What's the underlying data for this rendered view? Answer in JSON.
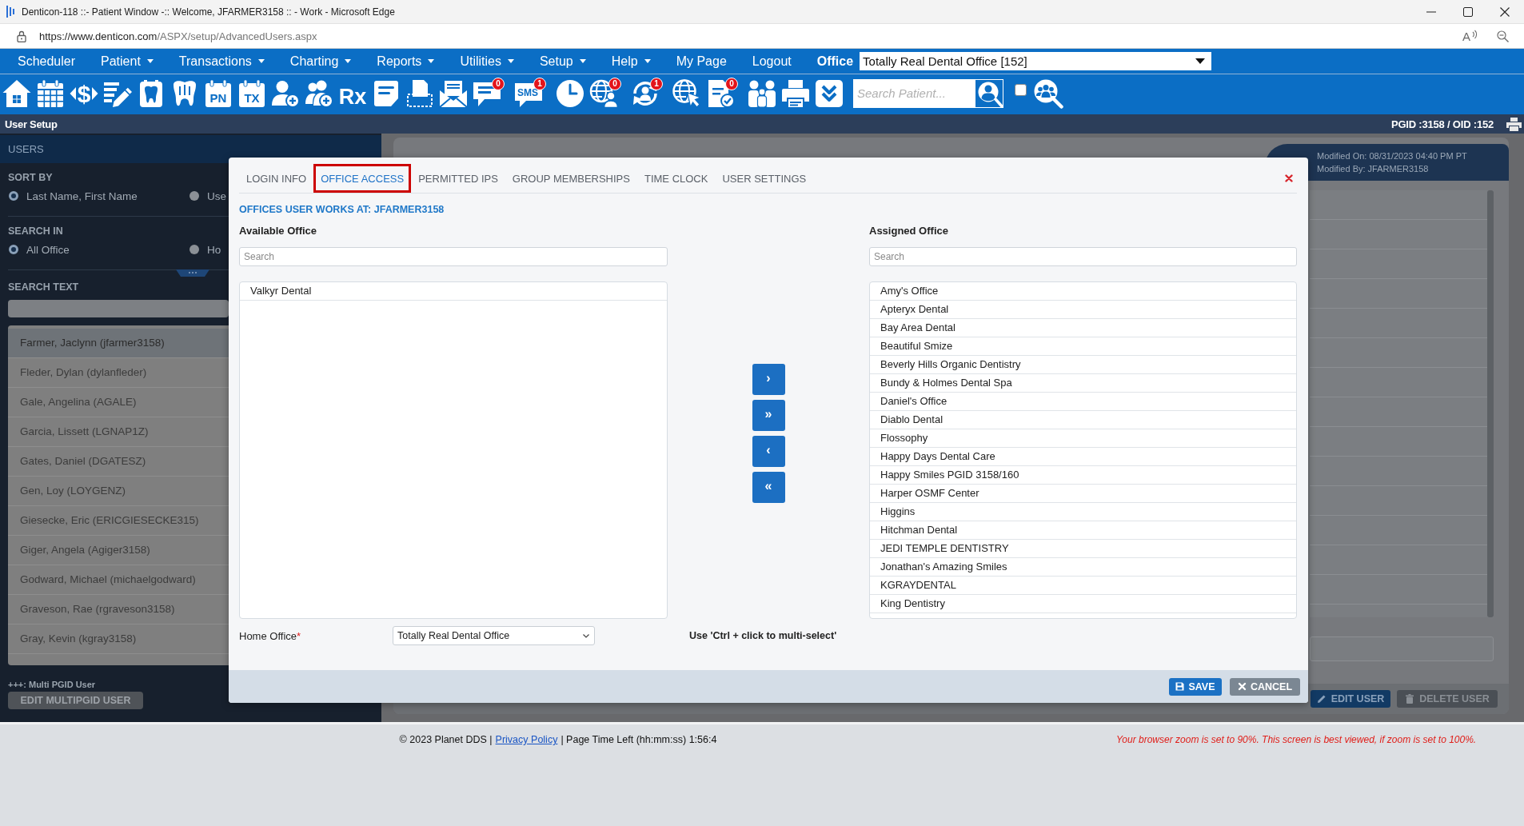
{
  "window": {
    "title": "Denticon-118 ::- Patient Window -:: Welcome, JFARMER3158 :: - Work - Microsoft Edge"
  },
  "address_bar": {
    "url_host": "https://www.denticon.com",
    "url_path": "/ASPX/setup/AdvancedUsers.aspx",
    "read_aloud_glyph": "A"
  },
  "menu": {
    "items": [
      {
        "label": "Scheduler",
        "dropdown": false
      },
      {
        "label": "Patient",
        "dropdown": true
      },
      {
        "label": "Transactions",
        "dropdown": true
      },
      {
        "label": "Charting",
        "dropdown": true
      },
      {
        "label": "Reports",
        "dropdown": true
      },
      {
        "label": "Utilities",
        "dropdown": true
      },
      {
        "label": "Setup",
        "dropdown": true
      },
      {
        "label": "Help",
        "dropdown": true
      },
      {
        "label": "My Page",
        "dropdown": false
      },
      {
        "label": "Logout",
        "dropdown": false
      }
    ],
    "office_label": "Office",
    "office_value": "Totally Real Dental Office [152]"
  },
  "toolbar": {
    "tools": [
      {
        "kind": "home"
      },
      {
        "kind": "calendar"
      },
      {
        "kind": "dollar",
        "label": "$"
      },
      {
        "kind": "edit_list"
      },
      {
        "kind": "tooth_card"
      },
      {
        "kind": "tooth"
      },
      {
        "kind": "document_label",
        "label": "PN"
      },
      {
        "kind": "document_label",
        "label": "TX"
      },
      {
        "kind": "person_add"
      },
      {
        "kind": "people_add"
      },
      {
        "kind": "rx",
        "label": "Rx"
      },
      {
        "kind": "note"
      },
      {
        "kind": "scanner"
      },
      {
        "kind": "envelope"
      },
      {
        "kind": "chat",
        "badge": "0"
      },
      {
        "kind": "sms",
        "label": "SMS",
        "badge": "1"
      },
      {
        "kind": "clock"
      },
      {
        "kind": "globe_person",
        "badge": "0"
      },
      {
        "kind": "refresh_person",
        "badge": "1"
      },
      {
        "kind": "globe_cursor"
      },
      {
        "kind": "document_check",
        "badge": "0"
      },
      {
        "kind": "family"
      },
      {
        "kind": "printer"
      },
      {
        "kind": "chevrons"
      }
    ],
    "search": {
      "placeholder": "Search Patient..."
    },
    "checkbox": {
      "checked": false
    }
  },
  "page_header": {
    "title": "User Setup",
    "ids": "PGID :3158 / OID :152"
  },
  "sidebar": {
    "header": "USERS",
    "sort_by": {
      "label": "SORT BY",
      "options": [
        {
          "label": "Last Name, First Name",
          "selected": true
        },
        {
          "label": "Use",
          "selected": false
        }
      ]
    },
    "search_in": {
      "label": "SEARCH IN",
      "options": [
        {
          "label": "All Office",
          "selected": true
        },
        {
          "label": "Ho",
          "selected": false
        }
      ]
    },
    "search_text": {
      "label": "SEARCH TEXT"
    },
    "users": [
      {
        "name": "Farmer, Jaclynn (jfarmer3158)",
        "selected": true
      },
      {
        "name": "Fleder, Dylan (dylanfleder)",
        "selected": false
      },
      {
        "name": "Gale, Angelina (AGALE)",
        "selected": false
      },
      {
        "name": "Garcia, Lissett (LGNAP1Z)",
        "selected": false
      },
      {
        "name": "Gates, Daniel (DGATESZ)",
        "selected": false
      },
      {
        "name": "Gen, Loy (LOYGENZ)",
        "selected": false
      },
      {
        "name": "Giesecke, Eric (ERICGIESECKE315)",
        "selected": false
      },
      {
        "name": "Giger, Angela (Agiger3158)",
        "selected": false
      },
      {
        "name": "Godward, Michael (michaelgodward)",
        "selected": false
      },
      {
        "name": "Graveson, Rae (rgraveson3158)",
        "selected": false
      },
      {
        "name": "Gray, Kevin (kgray3158)",
        "selected": false
      }
    ],
    "legend": "+++: Multi PGID User",
    "edit_button": {
      "label": "EDIT MULTIPGID USER",
      "disabled": true
    }
  },
  "user_details": {
    "modified_on": "Modified On: 08/31/2023 04:40 PM PT",
    "modified_by": "Modified By: JFARMER3158",
    "buttons": [
      {
        "kind": "edit",
        "label": "EDIT USER"
      },
      {
        "kind": "delete",
        "label": "DELETE USER"
      }
    ]
  },
  "dialog": {
    "tabs": [
      {
        "label": "LOGIN INFO",
        "selected": false
      },
      {
        "label": "OFFICE ACCESS",
        "selected": true
      },
      {
        "label": "PERMITTED IPS",
        "selected": false
      },
      {
        "label": "GROUP MEMBERSHIPS",
        "selected": false
      },
      {
        "label": "TIME CLOCK",
        "selected": false
      },
      {
        "label": "USER SETTINGS",
        "selected": false
      }
    ],
    "heading": "OFFICES USER WORKS AT: JFARMER3158",
    "available": {
      "title": "Available Office",
      "search_placeholder": "Search",
      "items": [
        "Valkyr Dental"
      ]
    },
    "assigned": {
      "title": "Assigned Office",
      "search_placeholder": "Search",
      "items": [
        "Amy's Office",
        "Apteryx Dental",
        "Bay Area Dental",
        "Beautiful Smize",
        "Beverly Hills Organic Dentistry",
        "Bundy & Holmes Dental Spa",
        "Daniel's Office",
        "Diablo Dental",
        "Flossophy",
        "Happy Days Dental Care",
        "Happy Smiles PGID 3158/160",
        "Harper OSMF Center",
        "Higgins",
        "Hitchman Dental",
        "JEDI TEMPLE DENTISTRY",
        "Jonathan's Amazing Smiles",
        "KGRAYDENTAL",
        "King Dentistry"
      ]
    },
    "transfer_buttons": [
      {
        "glyph": "›"
      },
      {
        "glyph": "»"
      },
      {
        "glyph": "‹"
      },
      {
        "glyph": "«"
      }
    ],
    "home_office": {
      "label": "Home Office",
      "required_mark": "*",
      "value": "Totally Real Dental Office"
    },
    "hint": "Use 'Ctrl + click to multi-select'",
    "buttons": [
      {
        "kind": "save",
        "label": "SAVE"
      },
      {
        "kind": "cancel",
        "label": "CANCEL"
      }
    ]
  },
  "footer": {
    "items": [
      {
        "kind": "text",
        "text": "© 2023 Planet DDS |"
      },
      {
        "kind": "link",
        "text": "Privacy Policy"
      },
      {
        "kind": "text",
        "text": "| Page Time Left (hh:mm:ss) 1:56:4"
      }
    ],
    "notice": "Your browser zoom is set to 90%. This screen is best viewed, if zoom is set to 100%."
  }
}
